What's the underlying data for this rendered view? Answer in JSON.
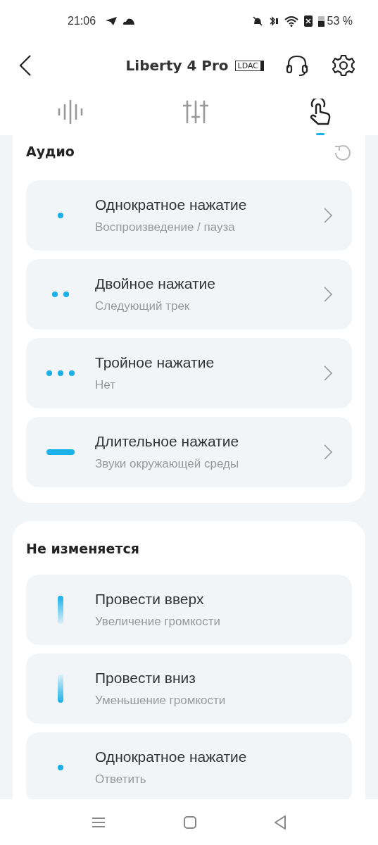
{
  "status_bar": {
    "time": "21:06",
    "battery": "53 %"
  },
  "header": {
    "title": "Liberty 4 Pro",
    "badge": "LDAC"
  },
  "tabs": [
    {
      "selected": false
    },
    {
      "selected": false
    },
    {
      "selected": true
    }
  ],
  "sections": [
    {
      "title": "Аудио",
      "reset": true,
      "items": [
        {
          "kind": "single",
          "title": "Однократное нажатие",
          "value": "Воспроизведение / пауза",
          "chevron": true
        },
        {
          "kind": "double",
          "title": "Двойное нажатие",
          "value": "Следующий трек",
          "chevron": true
        },
        {
          "kind": "triple",
          "title": "Тройное нажатие",
          "value": "Нет",
          "chevron": true
        },
        {
          "kind": "long",
          "title": "Длительное нажатие",
          "value": "Звуки окружающей среды",
          "chevron": true
        }
      ]
    },
    {
      "title": "Не изменяется",
      "reset": false,
      "items": [
        {
          "kind": "swipe_up",
          "title": "Провести вверх",
          "value": "Увеличение громкости",
          "chevron": false
        },
        {
          "kind": "swipe_down",
          "title": "Провести вниз",
          "value": "Уменьшение громкости",
          "chevron": false
        },
        {
          "kind": "single",
          "title": "Однократное нажатие",
          "value": "Ответить",
          "chevron": false
        }
      ]
    }
  ]
}
